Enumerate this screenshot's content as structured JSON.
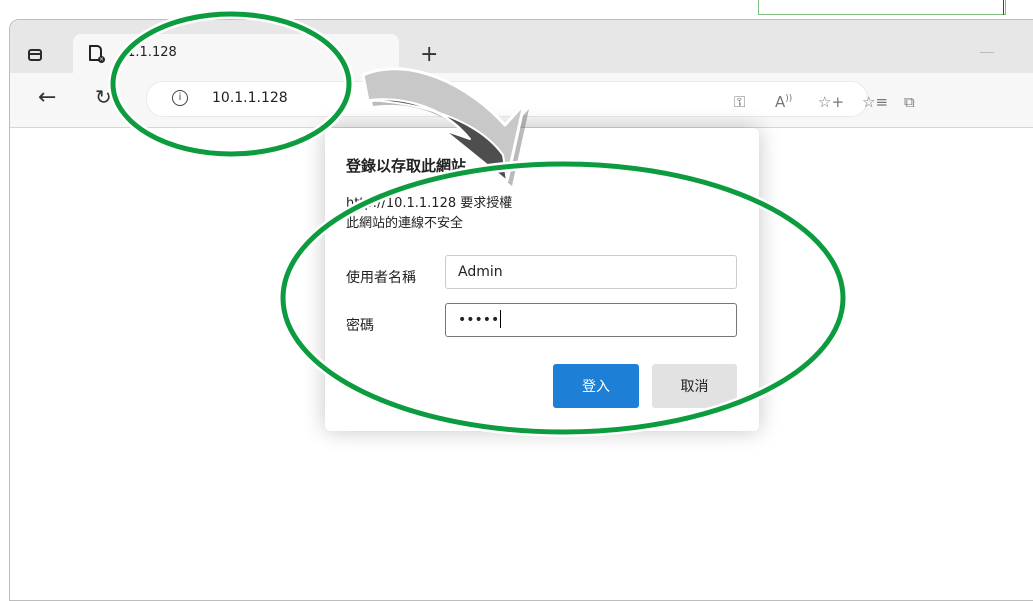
{
  "browser": {
    "tab_title": ".1.1.128",
    "address_url": "10.1.1.128",
    "new_tab_label": "+"
  },
  "dialog": {
    "title": "登錄以存取此網站",
    "auth_request": "http://10.1.1.128 要求授權",
    "connection_warning": "此網站的連線不安全",
    "username_label": "使用者名稱",
    "username_value": "Admin",
    "password_label": "密碼",
    "password_value": "•••••",
    "login_button": "登入",
    "cancel_button": "取消"
  },
  "icons": {
    "tab_actions": "tab-actions-icon",
    "page": "page-icon",
    "back": "back-icon",
    "refresh": "refresh-icon",
    "site_info": "info-icon",
    "key": "key-icon",
    "read_aloud": "read-aloud-icon",
    "add_favorite": "add-favorite-icon",
    "favorites": "favorites-icon",
    "collections": "collections-icon"
  },
  "colors": {
    "highlight_green": "#0c9b3f",
    "primary_blue": "#1e7fd6",
    "arrow_gray": "#c8c8c8"
  }
}
